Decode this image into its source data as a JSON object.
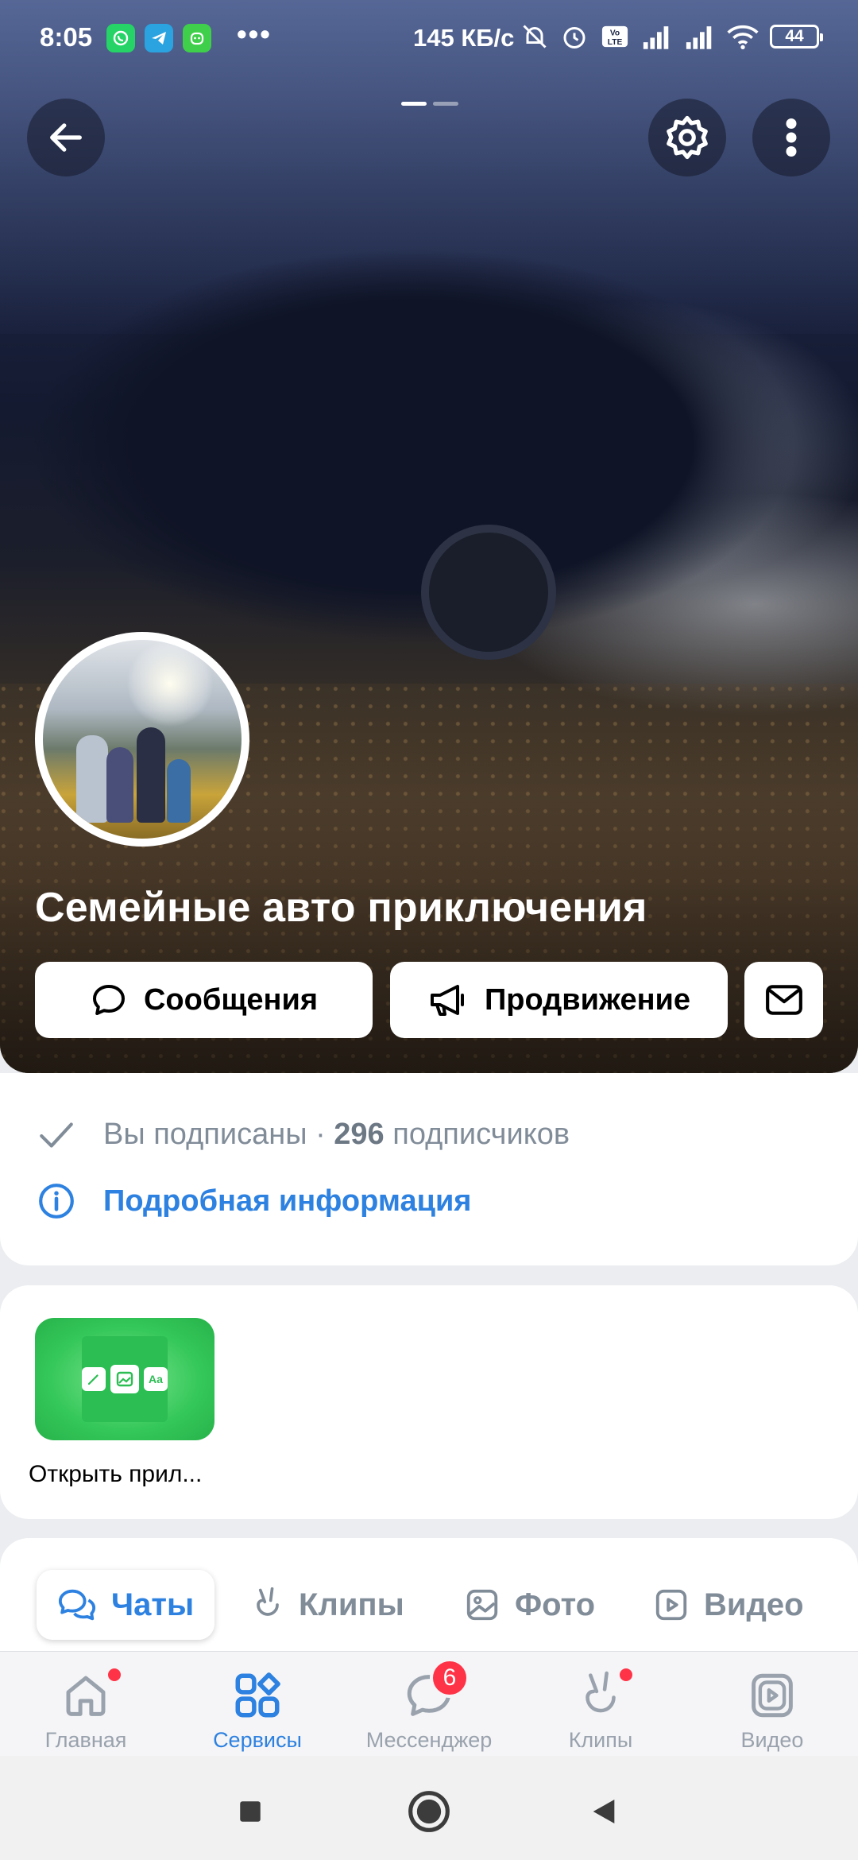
{
  "status_bar": {
    "time": "8:05",
    "notification_apps": [
      "whatsapp-icon",
      "telegram-icon",
      "android-robot-icon"
    ],
    "more": "•••",
    "speed": "145 КБ/с",
    "battery": "44"
  },
  "cover": {
    "pager": {
      "count": 2,
      "active": 0
    }
  },
  "group": {
    "name": "Семейные авто приключения"
  },
  "actions": {
    "messages": "Сообщения",
    "promotion": "Продвижение"
  },
  "info": {
    "subscribed": "Вы подписаны",
    "separator": "·",
    "followers_count": "296",
    "followers_label": "подписчиков",
    "details_link": "Подробная информация"
  },
  "mini_app": {
    "label": "Открыть прил...",
    "pill_text": "Aa"
  },
  "tabs": [
    {
      "label": "Чаты",
      "icon": "chats-icon",
      "active": true
    },
    {
      "label": "Клипы",
      "icon": "clips-icon",
      "active": false
    },
    {
      "label": "Фото",
      "icon": "photo-icon",
      "active": false
    },
    {
      "label": "Видео",
      "icon": "video-icon",
      "active": false
    }
  ],
  "bottom_nav": [
    {
      "label": "Главная",
      "icon": "home-icon",
      "dot": true
    },
    {
      "label": "Сервисы",
      "icon": "services-icon",
      "active": true
    },
    {
      "label": "Мессенджер",
      "icon": "messenger-icon",
      "badge": "6"
    },
    {
      "label": "Клипы",
      "icon": "clips-icon",
      "dot": true
    },
    {
      "label": "Видео",
      "icon": "video-icon"
    }
  ],
  "colors": {
    "accent": "#2d81e0",
    "muted": "#818c99",
    "badge": "#ff3347",
    "mini_app_green": "#34c759"
  }
}
